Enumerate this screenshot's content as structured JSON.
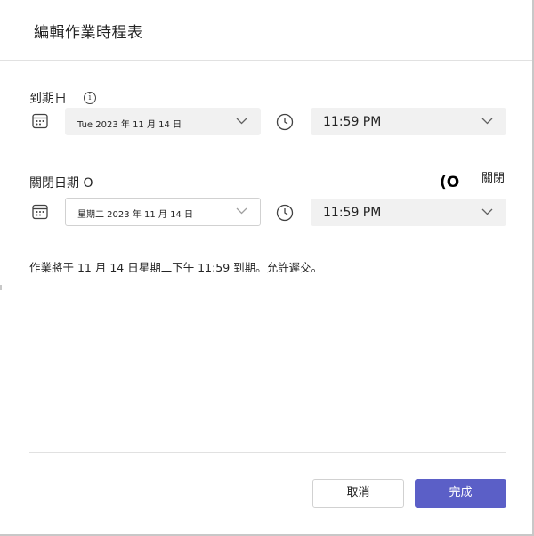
{
  "dialog": {
    "title": "編輯作業時程表"
  },
  "due": {
    "label": "到期日",
    "info_icon": "i",
    "date_value": "Tue 2023 年 11 月 14 日",
    "time_value": "11:59 PM"
  },
  "close": {
    "label": "關閉日期 O",
    "toggle_glyph": "(O",
    "toggle_label": "關閉",
    "date_value": "星期二 2023 年 11 月 14 日",
    "time_value": "11:59 PM"
  },
  "summary": "作業將于 11 月 14 日星期二下午 11:59 到期。允許遲交。",
  "footer": {
    "cancel_label": "取消",
    "done_label": "完成"
  },
  "colors": {
    "primary": "#5b5fc7",
    "field_bg": "#f1f1f1"
  },
  "icons": [
    "info-icon",
    "calendar-icon",
    "clock-icon",
    "chevron-down-icon"
  ]
}
